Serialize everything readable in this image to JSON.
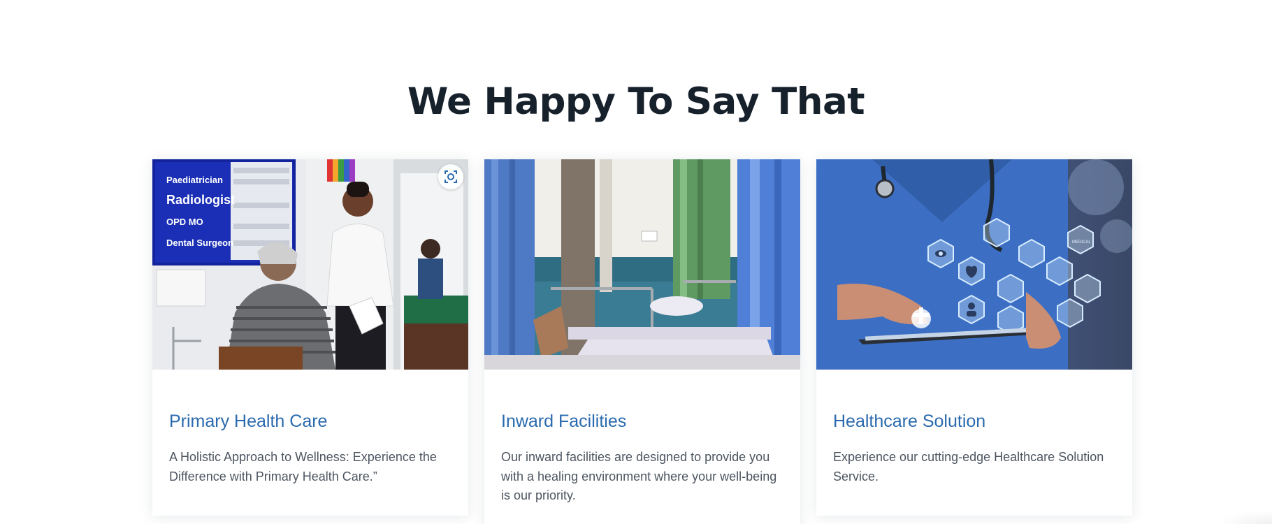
{
  "section": {
    "title": "We Happy To Say That"
  },
  "cards": [
    {
      "title": "Primary Health Care",
      "text": "A Holistic Approach to Wellness: Experience the Difference with Primary Health Care.”",
      "image": {
        "signs": [
          "Paediatrician",
          "Radiologist",
          "OPD MO",
          "Dental Surgeon"
        ]
      }
    },
    {
      "title": "Inward Facilities",
      "text": "Our inward facilities are designed to provide you with a healing environment where your well-being is our priority."
    },
    {
      "title": "Healthcare Solution",
      "text": "Experience our cutting-edge Healthcare Solution Service.",
      "image": {
        "hex_label": "MEDICAL"
      }
    }
  ],
  "icons": {
    "lens": "lens-search-icon"
  },
  "colors": {
    "heading": "#17212c",
    "card_title": "#2a6aae",
    "body_text": "#4d5560"
  }
}
